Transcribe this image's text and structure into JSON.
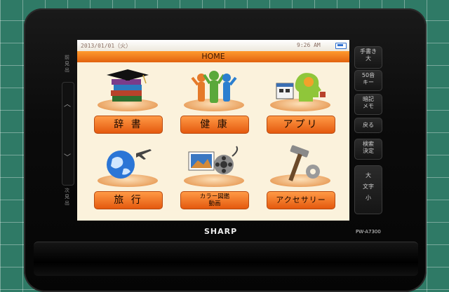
{
  "status": {
    "date": "2013/01/01（火）",
    "time": "9:26 AM",
    "battery": "battery-icon"
  },
  "header": {
    "title": "HOME"
  },
  "tiles": [
    {
      "label": "辞 書",
      "icon": "books-icon"
    },
    {
      "label": "健 康",
      "icon": "people-icon"
    },
    {
      "label": "アプリ",
      "icon": "head-calendar-icon"
    },
    {
      "label": "旅 行",
      "icon": "globe-plane-icon"
    },
    {
      "label": "カラー図鑑\n動画",
      "icon": "photo-film-icon"
    },
    {
      "label": "アクセサリー",
      "icon": "tools-icon"
    }
  ],
  "left_side": {
    "prev": "前見出",
    "next": "次見出",
    "up": "︿",
    "down": "﹀"
  },
  "right_buttons": [
    {
      "label": "手書き\n大"
    },
    {
      "label": "50音\nキー"
    },
    {
      "label": "暗記\nメモ"
    },
    {
      "label": "戻る"
    },
    {
      "label": "検索\n決定"
    },
    {
      "label": "大\n文字\n小"
    }
  ],
  "device": {
    "brand": "SHARP",
    "model": "PW-A7300"
  },
  "colors": {
    "accent": "#e4590e",
    "background": "#fbf2dc"
  }
}
